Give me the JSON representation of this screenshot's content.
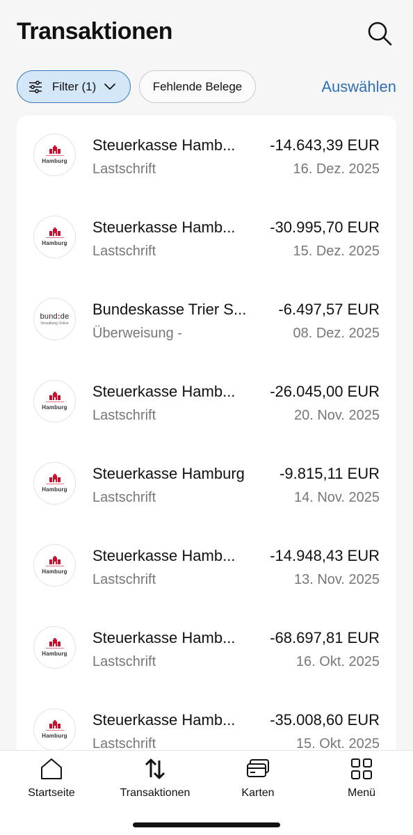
{
  "header": {
    "title": "Transaktionen",
    "search_icon": "search-icon"
  },
  "filters": {
    "filter_chip_label": "Filter (1)",
    "filter_chip_active": true,
    "missing_receipts_label": "Fehlende Belege",
    "select_label": "Auswählen"
  },
  "transactions": [
    {
      "logo": "hamburg-logo",
      "logo_text": "Hamburg",
      "name": "Steuerkasse Hamb...",
      "type": "Lastschrift",
      "amount": "-14.643,39 EUR",
      "date": "16. Dez. 2025"
    },
    {
      "logo": "hamburg-logo",
      "logo_text": "Hamburg",
      "name": "Steuerkasse Hamb...",
      "type": "Lastschrift",
      "amount": "-30.995,70 EUR",
      "date": "15. Dez. 2025"
    },
    {
      "logo": "bund-logo",
      "logo_text": "bund:de",
      "logo_subtext": "Verwaltung Online",
      "name": "Bundeskasse Trier S...",
      "type": "Überweisung -",
      "amount": "-6.497,57 EUR",
      "date": "08. Dez. 2025"
    },
    {
      "logo": "hamburg-logo",
      "logo_text": "Hamburg",
      "name": "Steuerkasse Hamb...",
      "type": "Lastschrift",
      "amount": "-26.045,00 EUR",
      "date": "20. Nov. 2025"
    },
    {
      "logo": "hamburg-logo",
      "logo_text": "Hamburg",
      "name": "Steuerkasse Hamburg",
      "type": "Lastschrift",
      "amount": "-9.815,11 EUR",
      "date": "14. Nov. 2025"
    },
    {
      "logo": "hamburg-logo",
      "logo_text": "Hamburg",
      "name": "Steuerkasse Hamb...",
      "type": "Lastschrift",
      "amount": "-14.948,43 EUR",
      "date": "13. Nov. 2025"
    },
    {
      "logo": "hamburg-logo",
      "logo_text": "Hamburg",
      "name": "Steuerkasse Hamb...",
      "type": "Lastschrift",
      "amount": "-68.697,81 EUR",
      "date": "16. Okt. 2025"
    },
    {
      "logo": "hamburg-logo",
      "logo_text": "Hamburg",
      "name": "Steuerkasse Hamb...",
      "type": "Lastschrift",
      "amount": "-35.008,60 EUR",
      "date": "15. Okt. 2025"
    }
  ],
  "bottom_nav": [
    {
      "label": "Startseite",
      "icon": "home-icon"
    },
    {
      "label": "Transaktionen",
      "icon": "transfer-arrows-icon",
      "active": true
    },
    {
      "label": "Karten",
      "icon": "cards-icon"
    },
    {
      "label": "Menü",
      "icon": "grid-menu-icon"
    }
  ],
  "colors": {
    "accent": "#2f6fb4",
    "chip_active_bg": "#d4e7f8",
    "chip_active_border": "#3a79bd",
    "background": "#f6f6f6",
    "card": "#ffffff",
    "secondary_text": "#777777",
    "hamburg_red": "#c8102e"
  }
}
